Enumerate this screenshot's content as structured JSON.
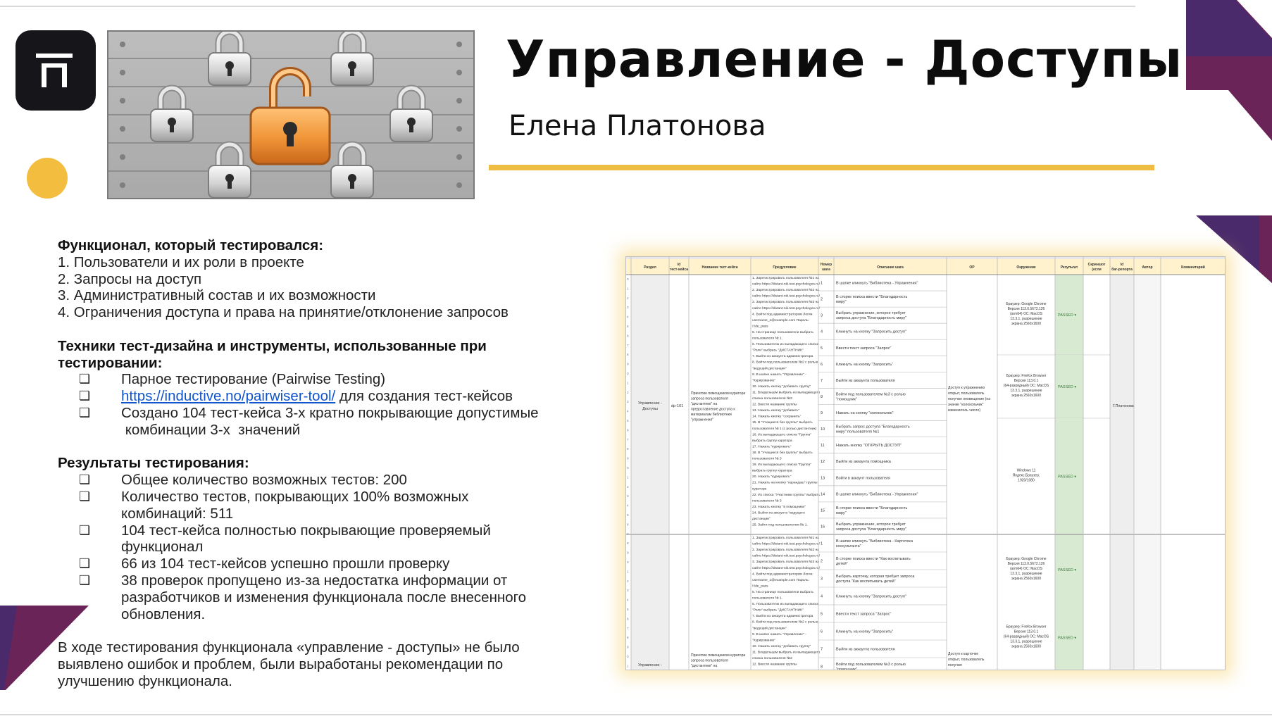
{
  "slide": {
    "title": "Управление - Доступы",
    "author": "Елена Платонова"
  },
  "icons": {
    "logo": "logo-mark-icon",
    "banner": "padlocks-illustration",
    "dot": "yellow-dot"
  },
  "colors": {
    "accent_gold": "#efbd43",
    "dot_yellow": "#f3bd3f",
    "purple_dark": "#4a2a6b",
    "purple_mid": "#6b2458",
    "logo_bg": "#15151a",
    "sheet_header": "#fff2cc",
    "sheet_passed": "#d9ead3"
  },
  "content": {
    "functional_heading": "Функционал, который тестировался:",
    "functional_items": [
      "1. Пользователи и их роли в проекте",
      "2. Запросы на доступ",
      "3. Административный состав и их возможности",
      "4. Ограничения доступа и права на принятие/отклонение запросов"
    ],
    "techniques_heading_1": "Техники тест-дизайна и инструменты, использованные при",
    "techniques_heading_2": "тестировании:",
    "bullet_glyph": "❏",
    "tech_item_1": "Парное тестирование (Pairwise Testing)",
    "tech_item_2_link": "https://inductive.no/pairwiser-tool/",
    "tech_item_2_rest": " для создания тест-кейсов",
    "tech_item_3_line1": "Создано 104 тест-кейса 3-х кратно покрывающие допустимые",
    "tech_item_3_line2": " комбинации 3-х  значений",
    "results_heading": "Результаты тестирования:",
    "result_1": "Общее количество возможных тестов: 200",
    "result_2_line1": "Количество тестов, покрывающих 100% возможных",
    "result_2_line2": "комбинаций: 511",
    "result_3_line1": "104 тест-кейса полностью покрывающие проверяемый",
    "result_3_line2": "функционал",
    "result_4": "66 из 104 тест-кейсов успешно прошли проверку",
    "result_5_line1": "38 проверок пропущено из-за недостатка информации от",
    "result_5_line2": "разработчиков и изменения функционала после внесенного",
    "result_5_line3": "обновления.",
    "conclusion_line1": "В ходе тестирования функционала «управление - доступы» не было",
    "conclusion_line2": "выявлено ошибок и проблем, были выработаны рекомендации по",
    "conclusion_line3": "улучшению функционала."
  },
  "spreadsheet": {
    "headers": [
      "Раздел",
      "Id тест-кейса",
      "Название тест-кейса",
      "Предусловие",
      "Номер шага",
      "Описание шага",
      "ОР",
      "Окружение",
      "Результат",
      "Скриншот (если необходимо)",
      "Id баг-репорта",
      "Автор",
      "Комментарий"
    ],
    "section": "Управление - Доступы",
    "case_id": "dp-101",
    "case_title": "Принятие помощником куратора запроса пользователя \"дистантник\" на предоставление доступа к материалам библиотеки \"упражнения\"",
    "preconditions": [
      "1. Зарегистрировать пользователя №1 на",
      "сайте https://distant-nik.test.psychologos.ru/",
      "2. Зарегистрировать пользователя №2 на",
      "сайте https://distant-nik.test.psychologos.ru/",
      "3. Зарегистрировать пользователя №3 на",
      "сайте https://distant-nik.test.psychologos.ru/",
      "4. Войти под администратором Логин:",
      "username_1@example.com Пароль:",
      "!!!de_pass",
      "5. На странице пользователи выбрать",
      "пользователя № 1.",
      "6. Пользователю из выпадающего списка",
      "\"Роли\" выбрать \"ДИСТАНТНИК\"",
      "7. Выйти из аккаунта администратора",
      "8. Войти под пользователем №2 с ролью",
      "\"ведущий дистанции\"",
      "9. В шапке нажать \"Управление\" -",
      "\"Курирование\"",
      "10. Нажать кнопку \"добавить группу\"",
      "11. Владельцем выбрать из выпадающего",
      "списка пользователя №2",
      "12. Ввести название группы",
      "13. Нажать кнопку \"добавить\"",
      "14. Нажать кнопку \"сохранить\"",
      "15. В \"Учащиеся без группы\" выбрать",
      "пользователя № 1 (с ролью дистантник)",
      "16. Из выпадающего списка \"Группа\"",
      "выбрать группу куратора",
      "17. Нажать \"курировать\"",
      "18. В \"Учащиеся без группы\" выбрать",
      "пользователя № 3",
      "19. Из выпадающего списка \"Группа\"",
      "выбрать группу куратора",
      "20. Нажать \"курировать\"",
      "21. Нажать на кнопку \"карандаш\" группы",
      "куратора",
      "22. Из списка \"Участники группы\" выбрать",
      "пользователя № 3",
      "23. Нажать кнопку \"в помощники\"",
      "24. Выйти из аккаунта \"ведущего",
      "дистанции\"",
      "25. Зайти под пользователем № 1."
    ],
    "steps": [
      {
        "n": "1",
        "text": "В шапке кликнуть \"Библиотека - Упражнения\""
      },
      {
        "n": "2",
        "text": "В сторке поиска ввести \"Благодарность миру\""
      },
      {
        "n": "3",
        "text": "Выбрать упражнение, которое требует запроса доступа \"Благодарность миру\""
      },
      {
        "n": "4",
        "text": "Кликнуть на кнопку \"Запросить доступ\""
      },
      {
        "n": "5",
        "text": "Ввести текст запроса \"Запрос\""
      },
      {
        "n": "6",
        "text": "Кликнуть на кнопку \"Запросить\""
      },
      {
        "n": "7",
        "text": "Выйти из аккаунта пользователя"
      },
      {
        "n": "8",
        "text": "Войти под пользователем №3 с ролью \"помощник\""
      },
      {
        "n": "9",
        "text": "Нажать на кнопку \"колокольчик\""
      },
      {
        "n": "10",
        "text": "Выбрать запрос доступа \"Благодарность миру\" пользователя №1"
      },
      {
        "n": "11",
        "text": "Нажать кнопку \"ОТКРЫТЬ ДОСТУП\""
      },
      {
        "n": "12",
        "text": "Выйти из аккаунта помощника"
      },
      {
        "n": "13",
        "text": "Войти в аккаунт пользователя"
      },
      {
        "n": "14",
        "text": "В шапке кликнуть \"Библиотека - Упражнения\""
      },
      {
        "n": "15",
        "text": "В сторке поиска ввести \"Благодарность миру\""
      },
      {
        "n": "16",
        "text": "Выбрать упражнение, которое требует запроса доступа \"Благодарность миру\""
      }
    ],
    "expected": "Доступ к упражнению открыт, пользователь получил оповещение (на значке \"колокольчик\" изменилось число)",
    "environments": [
      "Браузер: Google Chrome Версия 113.0.5672.126 (arm64) ОС: MacOS 13.3.1, разрешение экрана 2560х1600",
      "Браузер: Firefox Browser Версия 113.0.1 (64-разрядный) ОС: MacOS 13.3.1, разрешение экрана 2560х1600",
      "Windows 11 Яндекс.Браузер, 1920/1080"
    ],
    "result": "PASSED",
    "author": "Г.Платонова",
    "steps_2": [
      {
        "n": "1",
        "text": "В шапке кликнуть \"Библиотека - Картотека консультанта\""
      },
      {
        "n": "2",
        "text": "В сторке поиска ввести \"Как воспитывать детей\""
      },
      {
        "n": "3",
        "text": "Выбрать карточку, которая требует запроса доступа \"Как воспитывать детей\""
      },
      {
        "n": "4",
        "text": "Кликнуть на кнопку \"Запросить доступ\""
      },
      {
        "n": "5",
        "text": "Ввести текст запроса \"Запрос\""
      },
      {
        "n": "6",
        "text": "Кликнуть на кнопку \"Запросить\""
      },
      {
        "n": "7",
        "text": "Выйти из аккаунта пользователя"
      },
      {
        "n": "8",
        "text": "Войти под пользователем №3 с ролью \"помощник\""
      }
    ],
    "expected_2": "Доступ к карточке открыт, пользователь получил",
    "environments_2": [
      "Браузер: Google Chrome Версия 113.0.5672.126 (arm64) ОС: MacOS 13.3.1, разрешение экрана 2560х1600",
      "Браузер: Firefox Browser Версия 113.0.1 (64-разрядный) ОС: MacOS 13.3.1, разрешение экрана 2560х1600"
    ]
  }
}
